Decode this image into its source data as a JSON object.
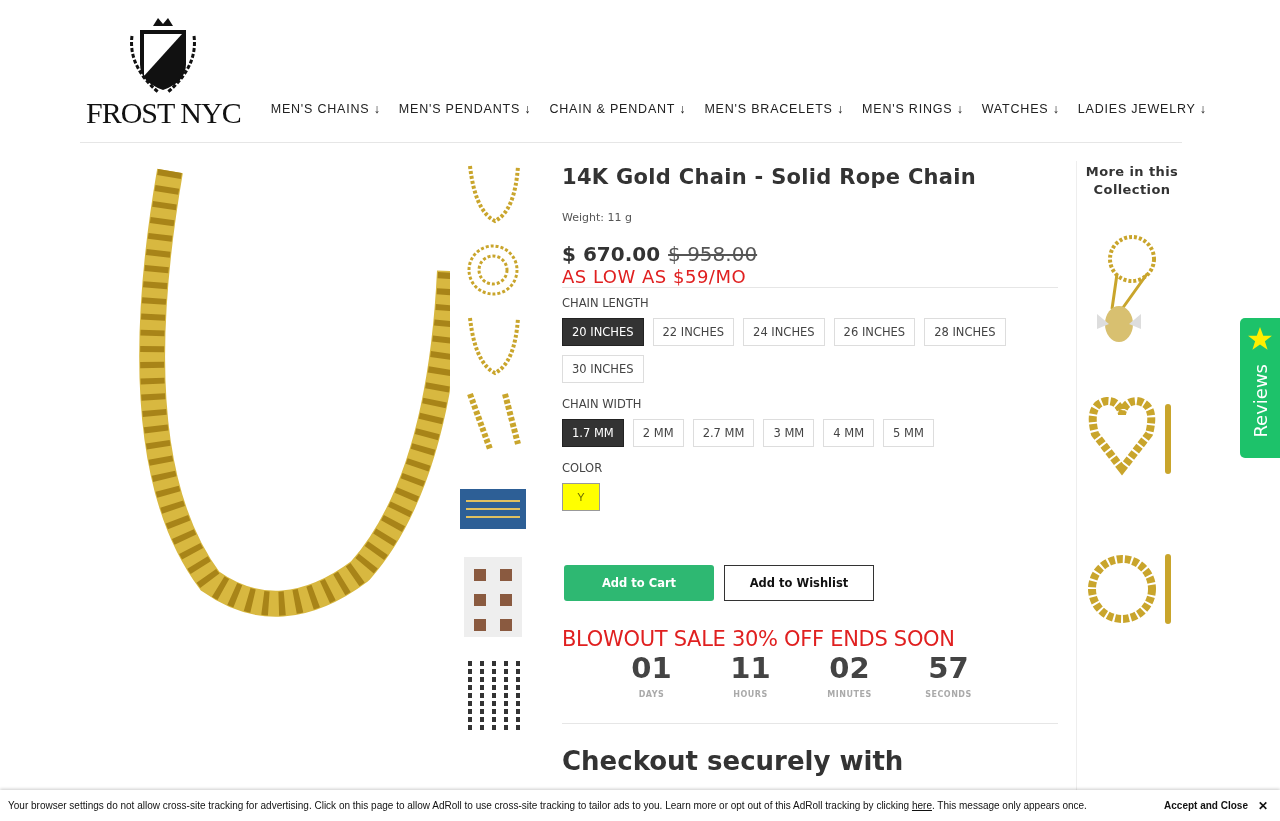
{
  "logo": {
    "text": "FROST NYC"
  },
  "nav": [
    {
      "label": "MEN'S CHAINS ↓"
    },
    {
      "label": "MEN'S PENDANTS ↓"
    },
    {
      "label": "CHAIN & PENDANT ↓"
    },
    {
      "label": "MEN'S BRACELETS ↓"
    },
    {
      "label": "MEN'S RINGS ↓"
    },
    {
      "label": "WATCHES ↓"
    },
    {
      "label": "LADIES JEWELRY ↓"
    }
  ],
  "gallery": {
    "thumbnails": [
      {
        "kind": "chain"
      },
      {
        "kind": "coil"
      },
      {
        "kind": "chain"
      },
      {
        "kind": "clasp"
      },
      {
        "kind": "chart"
      },
      {
        "kind": "grid"
      },
      {
        "kind": "widths"
      }
    ]
  },
  "product": {
    "title": "14K Gold Chain - Solid Rope Chain",
    "weight": "Weight: 11 g",
    "price": "$ 670.00",
    "old_price": "$ 958.00",
    "financing": "AS LOW AS $59/MO",
    "options": [
      {
        "label": "CHAIN LENGTH",
        "kind": "text",
        "values": [
          {
            "label": "20 INCHES",
            "selected": true
          },
          {
            "label": "22 INCHES",
            "selected": false
          },
          {
            "label": "24 INCHES",
            "selected": false
          },
          {
            "label": "26 INCHES",
            "selected": false
          },
          {
            "label": "28 INCHES",
            "selected": false
          },
          {
            "label": "30 INCHES",
            "selected": false
          }
        ]
      },
      {
        "label": "CHAIN WIDTH",
        "kind": "text",
        "values": [
          {
            "label": "1.7 MM",
            "selected": true
          },
          {
            "label": "2 MM",
            "selected": false
          },
          {
            "label": "2.7 MM",
            "selected": false
          },
          {
            "label": "3 MM",
            "selected": false
          },
          {
            "label": "4 MM",
            "selected": false
          },
          {
            "label": "5 MM",
            "selected": false
          }
        ]
      },
      {
        "label": "COLOR",
        "kind": "swatch",
        "values": [
          {
            "label": "Y",
            "color": "#ffff00"
          }
        ]
      }
    ],
    "buttons": [
      {
        "label": "Add to Cart",
        "kind": "primary"
      },
      {
        "label": "Add to Wishlist",
        "kind": "outline"
      }
    ],
    "sale": "BLOWOUT SALE 30% OFF ENDS SOON",
    "countdown": [
      {
        "value": "01",
        "unit": "DAYS"
      },
      {
        "value": "11",
        "unit": "HOURS"
      },
      {
        "value": "02",
        "unit": "MINUTES"
      },
      {
        "value": "57",
        "unit": "SECONDS"
      }
    ],
    "checkout_heading": "Checkout securely with"
  },
  "sidebar": {
    "title": "More in this Collection",
    "items": [
      {
        "kind": "pendant"
      },
      {
        "kind": "heart"
      },
      {
        "kind": "hoop"
      }
    ]
  },
  "reviews_tab": {
    "label": "Reviews"
  },
  "cookie_banner": {
    "text_before": "Your browser settings do not allow cross-site tracking for advertising. Click on this page to allow AdRoll to use cross-site tracking to tailor ads to you. Learn more or opt out of this AdRoll tracking by clicking ",
    "link": "here",
    "text_after": ". This message only appears once.",
    "accept": "Accept and Close",
    "close": "✕"
  }
}
